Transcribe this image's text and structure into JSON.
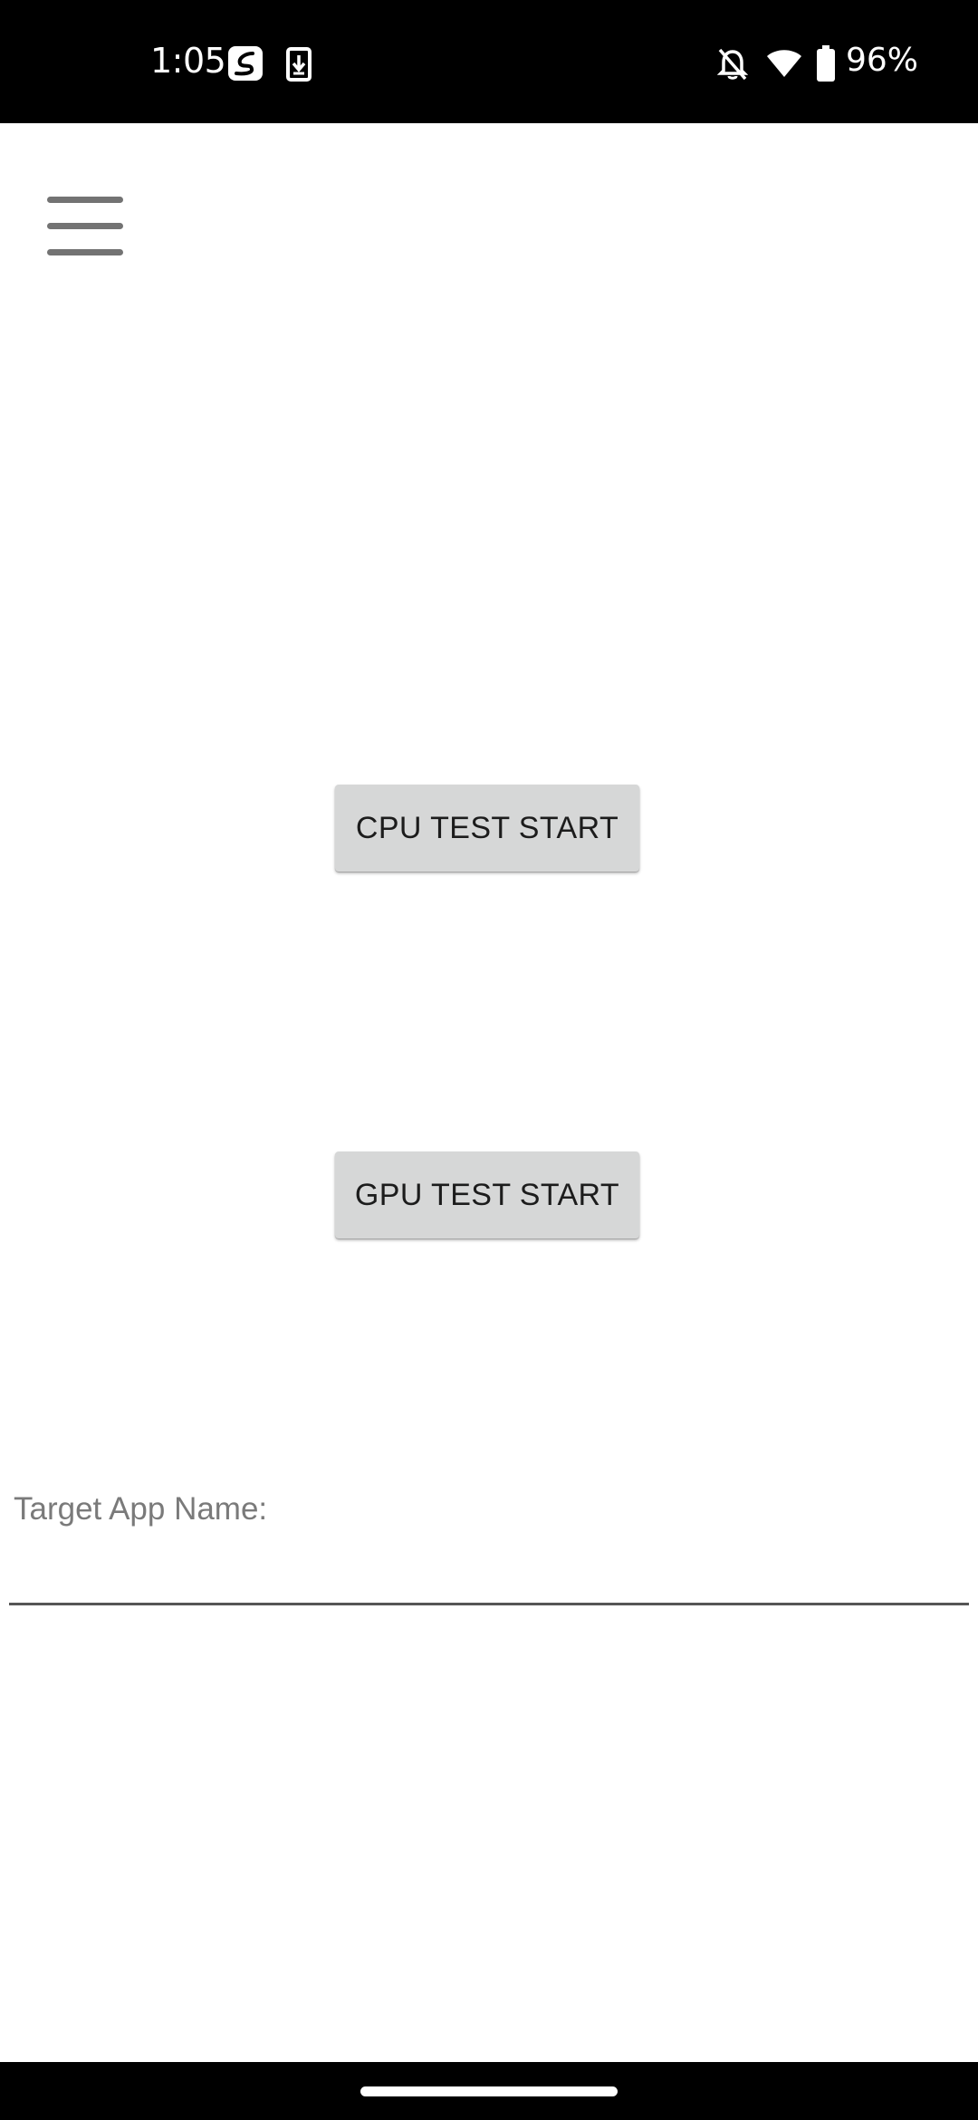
{
  "status_bar": {
    "time": "1:05",
    "battery_percent": "96%",
    "icons": [
      "app-notification-icon",
      "download-notification-icon",
      "do-not-disturb-icon",
      "wifi-icon",
      "battery-icon"
    ]
  },
  "toolbar": {
    "menu_icon": "hamburger-menu-icon"
  },
  "main": {
    "cpu_button_label": "CPU TEST START",
    "gpu_button_label": "GPU TEST START",
    "target_app_label": "Target App Name:",
    "target_app_value": ""
  },
  "colors": {
    "status_bar_bg": "#000000",
    "background": "#ffffff",
    "button_bg": "#d6d7d7",
    "label_text": "#7a7a7a",
    "menu_icon": "#737373"
  }
}
